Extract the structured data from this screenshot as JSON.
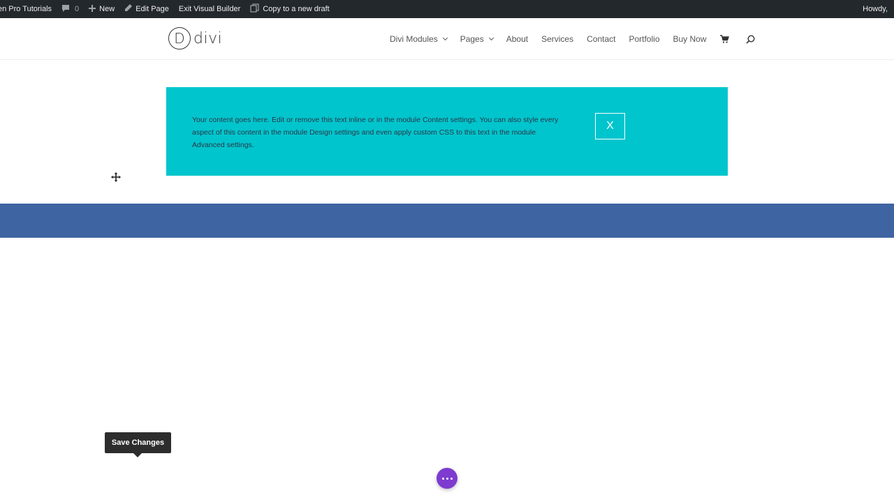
{
  "admin_bar": {
    "site_name": "en Pro Tutorials",
    "comments_count": "0",
    "new_label": "New",
    "edit_page_label": "Edit Page",
    "exit_builder_label": "Exit Visual Builder",
    "copy_draft_label": "Copy to a new draft",
    "howdy_label": "Howdy,"
  },
  "header": {
    "logo_letter": "D",
    "logo_text": "divi",
    "nav": [
      {
        "label": "Divi Modules"
      },
      {
        "label": "Pages"
      },
      {
        "label": "About"
      },
      {
        "label": "Services"
      },
      {
        "label": "Contact"
      },
      {
        "label": "Portfolio"
      },
      {
        "label": "Buy Now"
      }
    ],
    "cart_icon": "cart-icon",
    "search_icon": "search-icon"
  },
  "cta": {
    "text": "Your content goes here. Edit or remove this text inline or in the module Content settings. You can also style every aspect of this content in the module Design settings and even apply custom CSS to this text in the module Advanced settings.",
    "close_label": "X",
    "background": "#00c5cd"
  },
  "band": {
    "background": "#3e64a2"
  },
  "builder": {
    "save_tooltip": "Save Changes",
    "fab_icon": "more-dots-icon",
    "fab_color": "#7e3bd0",
    "move_icon": "move-icon"
  }
}
